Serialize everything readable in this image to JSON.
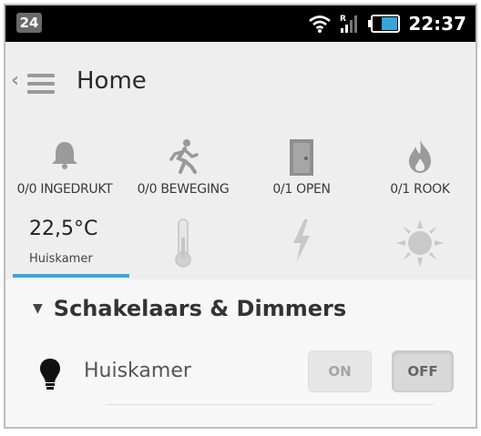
{
  "statusbar": {
    "notification_count": "24",
    "time": "22:37",
    "icons": [
      "wifi-icon",
      "signal-icon",
      "battery-icon"
    ]
  },
  "actionbar": {
    "title": "Home",
    "icons": [
      "back-chevron-icon",
      "menu-icon"
    ]
  },
  "sensors": [
    {
      "icon": "bell-icon",
      "label": "0/0 INGEDRUKT"
    },
    {
      "icon": "motion-icon",
      "label": "0/0 BEWEGING"
    },
    {
      "icon": "door-icon",
      "label": "0/1 OPEN"
    },
    {
      "icon": "flame-icon",
      "label": "0/1 ROOK"
    }
  ],
  "tiles": {
    "temperature": {
      "value": "22,5°C",
      "room": "Huiskamer"
    },
    "icons": [
      "thermometer-icon",
      "lightning-icon",
      "sun-icon"
    ]
  },
  "section": {
    "title": "Schakelaars & Dimmers",
    "expanded": true
  },
  "switches": [
    {
      "icon": "bulb-icon",
      "name": "Huiskamer",
      "on_label": "ON",
      "off_label": "OFF",
      "state": "off"
    }
  ],
  "colors": {
    "accent": "#39a8d8",
    "statusbar": "#000000",
    "background": "#eeeeee"
  }
}
